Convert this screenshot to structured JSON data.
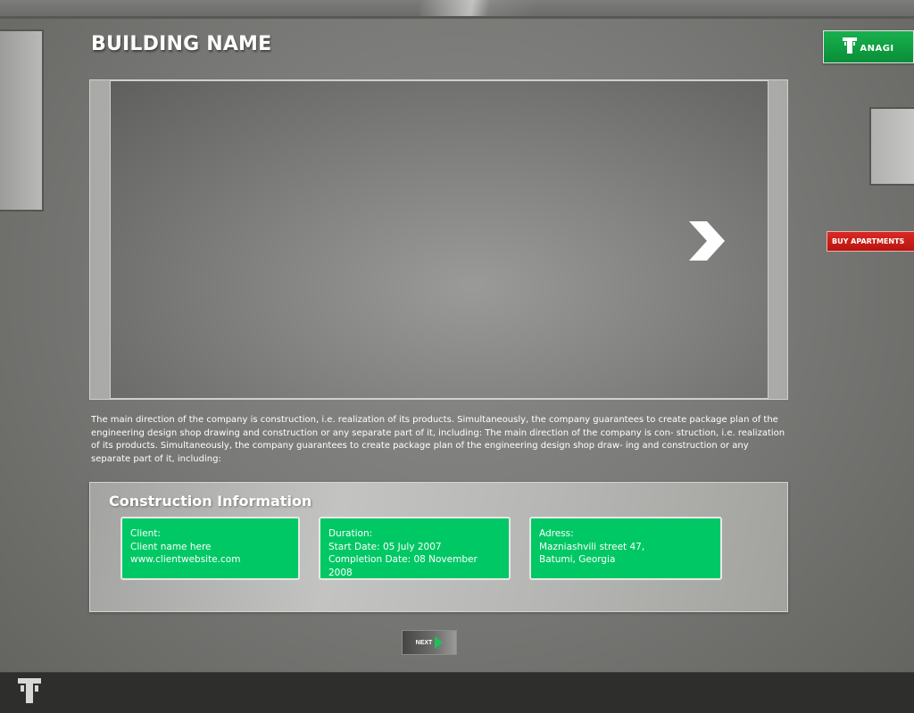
{
  "page": {
    "title": "BUILDING NAME"
  },
  "header": {
    "logo_text": "ANAGI",
    "logo_icon": "t-building-icon"
  },
  "side_buttons": {
    "buy_apartments": "BUY APARTMENTS"
  },
  "slider": {
    "next_icon": "chevron-right-icon"
  },
  "description": "The main direction of the company is construction, i.e. realization of its products. Simultaneously, the company guarantees to create package plan of the engineering design shop drawing and construction or any separate part of it, including: The main direction of the company is con- struction, i.e. realization of its products. Simultaneously, the company guarantees to create package plan of the engineering design shop draw- ing and construction or any separate part of it, including:",
  "construction_info": {
    "heading": "Construction Information",
    "client": {
      "label": "Client:",
      "name": "Client name here",
      "website": "www.clientwebsite.com"
    },
    "duration": {
      "label": "Duration:",
      "start": "Start Date: 05 July 2007",
      "completion": "Completion Date: 08 November 2008"
    },
    "address": {
      "label": "Adress:",
      "line1": "Mazniashvili street 47,",
      "line2": "Batumi, Georgia"
    }
  },
  "navigation": {
    "next_label": "NEXT"
  },
  "colors": {
    "accent_green": "#00c864",
    "buy_red": "#c8201a",
    "background_gray": "#7a7b78",
    "footer": "#2e2f2d"
  }
}
